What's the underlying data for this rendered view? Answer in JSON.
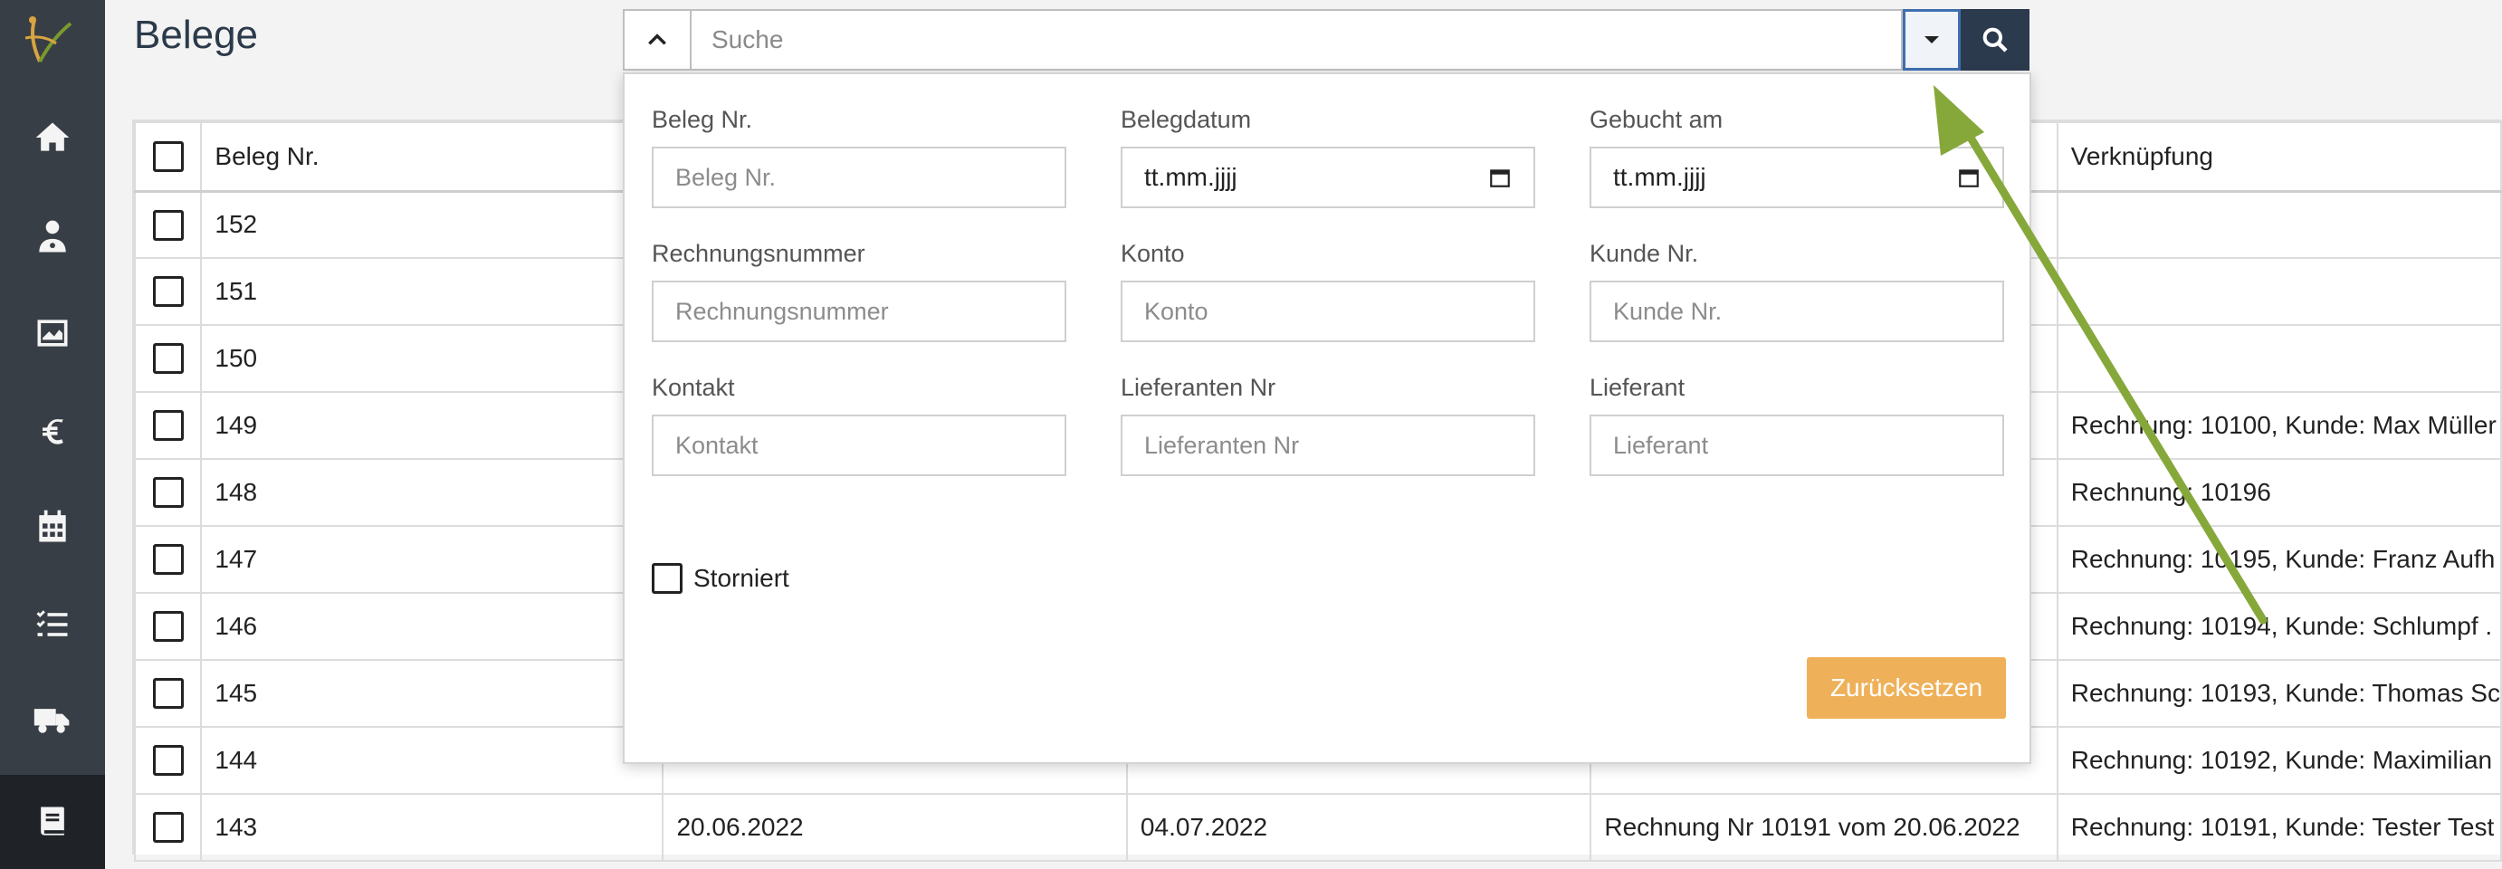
{
  "page": {
    "title": "Belege"
  },
  "search": {
    "placeholder": "Suche"
  },
  "table": {
    "headers": {
      "beleg_nr": "Beleg Nr.",
      "verknuepfung": "Verknüpfung"
    },
    "rows": [
      {
        "beleg_nr": "152",
        "col2": "",
        "col3": "",
        "col4": "",
        "verknuepfung": ""
      },
      {
        "beleg_nr": "151",
        "col2": "",
        "col3": "",
        "col4": "",
        "verknuepfung": ""
      },
      {
        "beleg_nr": "150",
        "col2": "",
        "col3": "",
        "col4": "",
        "verknuepfung": ""
      },
      {
        "beleg_nr": "149",
        "col2": "",
        "col3": "",
        "col4": "",
        "verknuepfung": "Rechnung: 10100, Kunde: Max Müller"
      },
      {
        "beleg_nr": "148",
        "col2": "",
        "col3": "",
        "col4": "",
        "verknuepfung": "Rechnung: 10196"
      },
      {
        "beleg_nr": "147",
        "col2": "",
        "col3": "",
        "col4": "",
        "verknuepfung": "Rechnung: 10195, Kunde: Franz Aufh"
      },
      {
        "beleg_nr": "146",
        "col2": "",
        "col3": "",
        "col4": "",
        "verknuepfung": "Rechnung: 10194, Kunde: Schlumpf ."
      },
      {
        "beleg_nr": "145",
        "col2": "",
        "col3": "",
        "col4": "",
        "verknuepfung": "Rechnung: 10193, Kunde: Thomas Sc"
      },
      {
        "beleg_nr": "144",
        "col2": "",
        "col3": "",
        "col4": "",
        "verknuepfung": "Rechnung: 10192, Kunde: Maximilian"
      },
      {
        "beleg_nr": "143",
        "col2": "20.06.2022",
        "col3": "04.07.2022",
        "col4": "Rechnung Nr 10191 vom 20.06.2022",
        "verknuepfung": "Rechnung: 10191, Kunde: Tester Test"
      }
    ]
  },
  "filters": {
    "beleg_nr": {
      "label": "Beleg Nr.",
      "placeholder": "Beleg Nr."
    },
    "belegdatum": {
      "label": "Belegdatum",
      "value": "tt.mm.jjjj"
    },
    "gebucht_am": {
      "label": "Gebucht am",
      "value": "tt.mm.jjjj"
    },
    "rechnungsnummer": {
      "label": "Rechnungsnummer",
      "placeholder": "Rechnungsnummer"
    },
    "konto": {
      "label": "Konto",
      "placeholder": "Konto"
    },
    "kunde_nr": {
      "label": "Kunde Nr.",
      "placeholder": "Kunde Nr."
    },
    "kontakt": {
      "label": "Kontakt",
      "placeholder": "Kontakt"
    },
    "lieferanten_nr": {
      "label": "Lieferanten Nr",
      "placeholder": "Lieferanten Nr"
    },
    "lieferant": {
      "label": "Lieferant",
      "placeholder": "Lieferant"
    },
    "storniert": {
      "label": "Storniert",
      "checked": false
    },
    "reset_label": "Zurücksetzen"
  },
  "icons": {
    "sidebar": [
      "logo",
      "home-icon",
      "doctor-icon",
      "chart-image-icon",
      "euro-icon",
      "calendar-icon",
      "checklist-icon",
      "truck-icon",
      "book-icon"
    ],
    "toggle": "chevron-up-icon",
    "dropdown": "caret-down-icon",
    "search": "search-icon"
  },
  "colors": {
    "sidebar": "#383e45",
    "search_button": "#2b3a4d",
    "reset_button": "#eeb15a",
    "annotation_arrow": "#86a83a"
  }
}
